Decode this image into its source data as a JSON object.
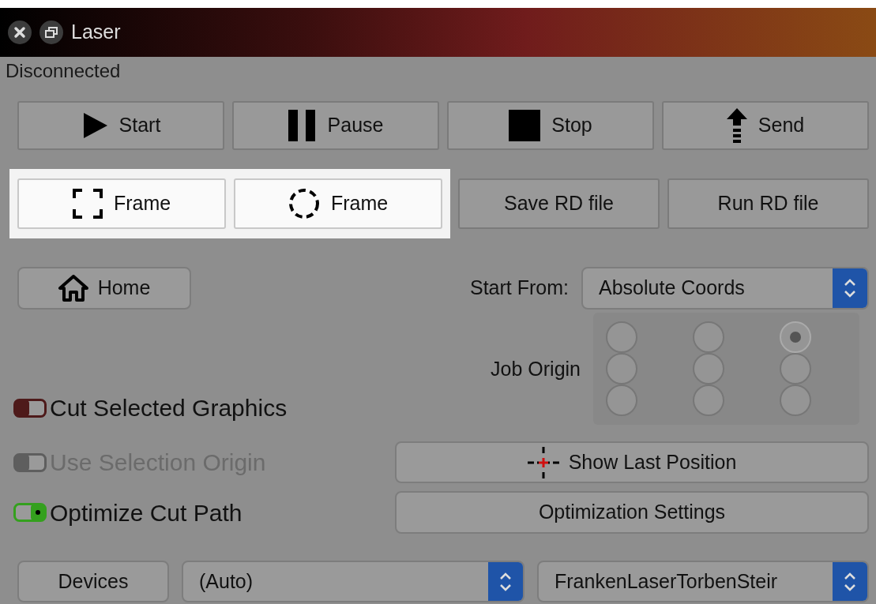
{
  "window": {
    "title": "Laser"
  },
  "status": "Disconnected",
  "action_buttons": [
    {
      "label": "Start",
      "kind": "play"
    },
    {
      "label": "Pause",
      "kind": "pause"
    },
    {
      "label": "Stop",
      "kind": "stop"
    },
    {
      "label": "Send",
      "kind": "send"
    }
  ],
  "file_buttons": [
    {
      "label": "Frame",
      "kind": "rect-frame",
      "highlighted": true
    },
    {
      "label": "Frame",
      "kind": "circle-frame",
      "highlighted": true
    },
    {
      "label": "Save RD file",
      "kind": "plain",
      "highlighted": false
    },
    {
      "label": "Run RD file",
      "kind": "plain",
      "highlighted": false
    }
  ],
  "home_button": {
    "label": "Home"
  },
  "start_from": {
    "label": "Start From:",
    "value": "Absolute Coords"
  },
  "job_origin": {
    "label": "Job Origin",
    "rows": [
      [
        {
          "selected": false
        },
        {
          "selected": false
        },
        {
          "selected": true
        }
      ],
      [
        {
          "selected": false
        },
        {
          "selected": false
        },
        {
          "selected": false
        }
      ],
      [
        {
          "selected": false
        },
        {
          "selected": false
        },
        {
          "selected": false
        }
      ]
    ]
  },
  "toggles": [
    {
      "label": "Cut Selected Graphics",
      "on": false,
      "disabled": false,
      "color": "#4e1a1a"
    },
    {
      "label": "Use Selection Origin",
      "on": false,
      "disabled": true,
      "color": "#5e5e5e"
    },
    {
      "label": "Optimize Cut Path",
      "on": true,
      "disabled": false,
      "color": "#34a01e"
    }
  ],
  "show_last_position": {
    "label": "Show Last Position"
  },
  "optimization_settings": {
    "label": "Optimization Settings"
  },
  "devices_button": {
    "label": "Devices"
  },
  "port_select": {
    "value": "(Auto)"
  },
  "device_select": {
    "value": "FrankenLaserTorbenSteir"
  }
}
